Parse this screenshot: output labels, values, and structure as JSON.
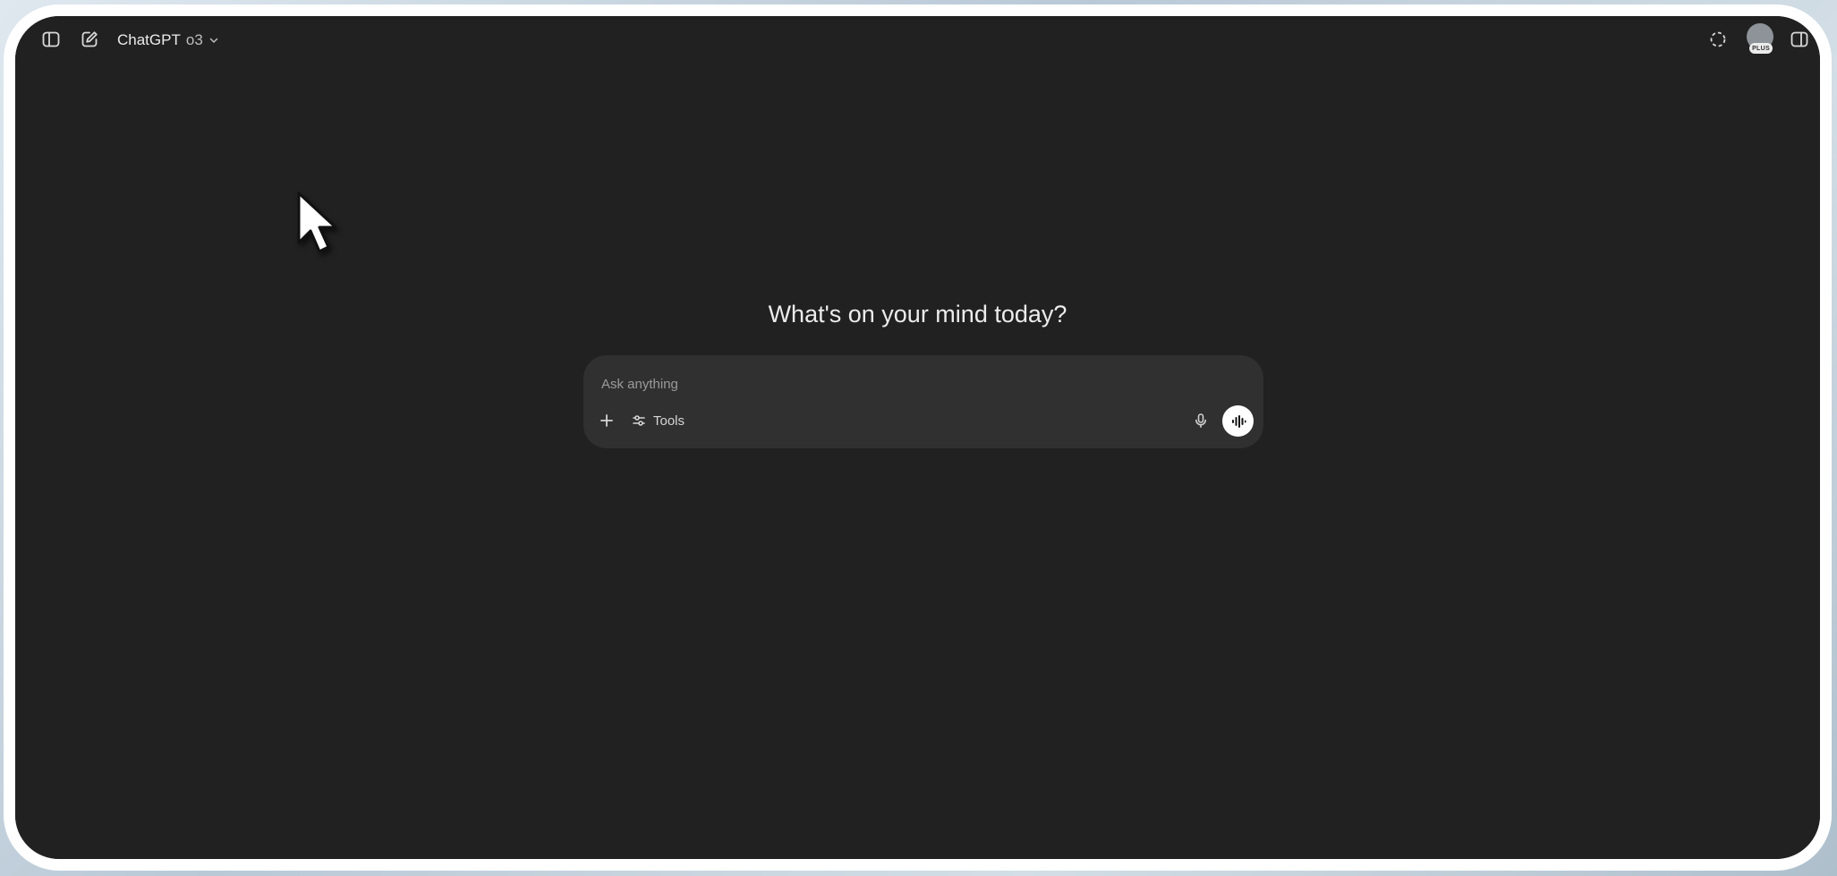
{
  "header": {
    "app_name": "ChatGPT",
    "model_name": "o3",
    "plan_badge": "PLUS"
  },
  "main": {
    "headline": "What's on your mind today?"
  },
  "composer": {
    "placeholder": "Ask anything",
    "tools_label": "Tools"
  },
  "icons": {
    "sidebar_toggle": "sidebar-icon",
    "new_chat": "compose-icon",
    "model_dropdown": "chevron-down-icon",
    "temporary_chat": "temporary-chat-icon",
    "canvas_toggle": "split-pane-icon",
    "attach": "plus-icon",
    "tools": "sliders-icon",
    "dictate": "microphone-icon",
    "voice_mode": "voice-waveform-icon",
    "pointer": "mouse-cursor-icon"
  },
  "colors": {
    "background": "#212121",
    "composer": "#303030",
    "frame": "#ffffff",
    "text": "#ececec"
  }
}
